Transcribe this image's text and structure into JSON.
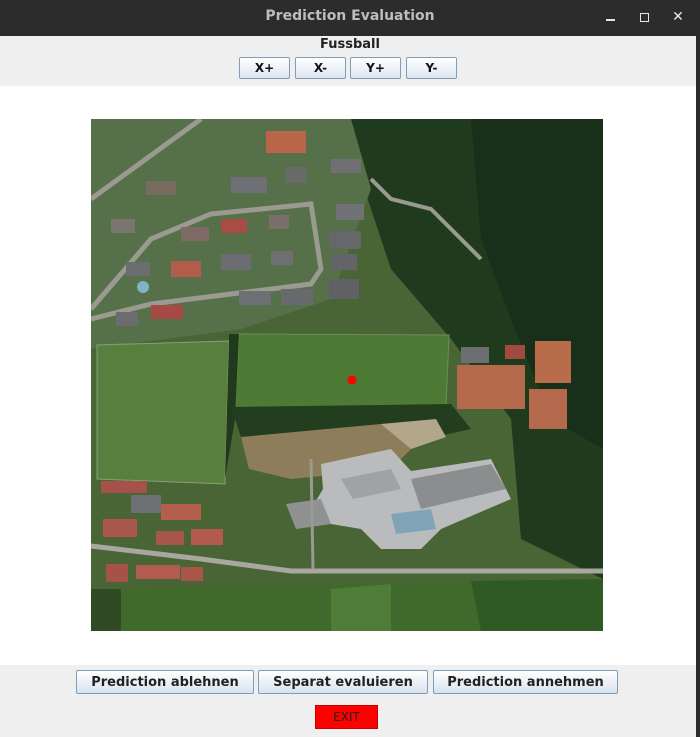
{
  "window": {
    "title": "Prediction Evaluation",
    "controls": {
      "minimize": "minimize",
      "maximize": "maximize",
      "close": "✕"
    }
  },
  "header": {
    "category": "Fussball",
    "nav_buttons": [
      "X+",
      "X-",
      "Y+",
      "Y-"
    ]
  },
  "map": {
    "type": "aerial-photo",
    "marker_color": "#ff0000"
  },
  "actions": {
    "reject": "Prediction ablehnen",
    "separate": "Separat evaluieren",
    "accept": "Prediction annehmen",
    "exit": "EXIT",
    "exit_color": "#ff0000"
  }
}
